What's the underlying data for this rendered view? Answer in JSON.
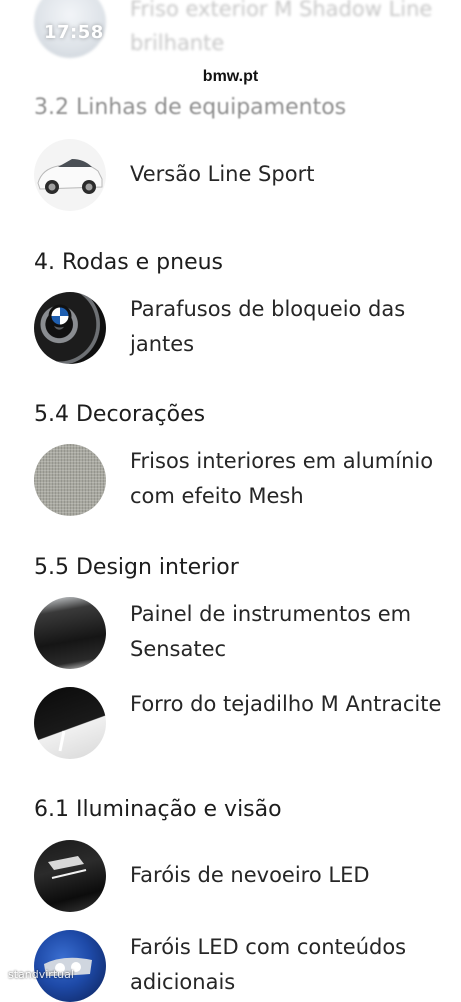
{
  "status_bar": {
    "time": "17:58"
  },
  "browser": {
    "domain": "bmw.pt"
  },
  "previous_item": {
    "text": "Friso exterior M Shadow Line brilhante"
  },
  "sections": [
    {
      "title": "3.2 Linhas de equipamentos",
      "items": [
        {
          "text": "Versão Line Sport",
          "icon": "car-thumbnail"
        }
      ]
    },
    {
      "title": "4. Rodas e pneus",
      "items": [
        {
          "text": "Parafusos de bloqueio das jantes",
          "icon": "wheel-thumbnail"
        }
      ]
    },
    {
      "title": "5.4 Decorações",
      "items": [
        {
          "text": "Frisos interiores em alumínio com efeito Mesh",
          "icon": "mesh-trim-thumbnail"
        }
      ]
    },
    {
      "title": "5.5 Design interior",
      "items": [
        {
          "text": "Painel de instrumentos em Sensatec",
          "icon": "dashboard-thumbnail"
        },
        {
          "text": "Forro do tejadilho M Antracite",
          "icon": "headliner-thumbnail"
        }
      ]
    },
    {
      "title": "6.1 Iluminação e visão",
      "items": [
        {
          "text": "Faróis de nevoeiro LED",
          "icon": "fog-light-thumbnail"
        },
        {
          "text": "Faróis LED com conteúdos adicionais",
          "icon": "led-headlight-thumbnail"
        }
      ]
    }
  ],
  "watermark": "standvirtual"
}
